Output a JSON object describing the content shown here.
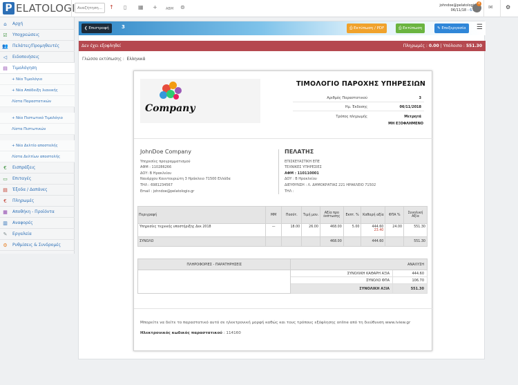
{
  "topbar": {
    "logo_letter": "P",
    "logo_text": "ELATOLOGIO",
    "search_placeholder": "Αναζήτηση...",
    "user_email": "johndoe@pelatologio.gr",
    "user_date": "06/11/18",
    "user_version": "6.2.87",
    "notif_count": "4"
  },
  "sidebar": {
    "items": [
      {
        "label": "Αρχή",
        "icon": "home-icon"
      },
      {
        "label": "Υποχρεώσεις",
        "icon": "check-icon"
      },
      {
        "label": "Πελάτες/Προμηθευτές",
        "icon": "users-icon"
      },
      {
        "label": "Ειδοποιήσεις",
        "icon": "megaphone-icon"
      },
      {
        "label": "Τιμολόγηση",
        "icon": "invoice-icon"
      }
    ],
    "subitems": [
      {
        "label": "+ Νέο Τιμολόγιο"
      },
      {
        "label": "+ Νέα Απόδειξη λιανικής"
      },
      {
        "label": "Λίστα Παραστατικών"
      },
      {
        "label": "+ Νέο Πιστωτικό Τιμολόγιο"
      },
      {
        "label": "Λίστα Πιστωτικών"
      },
      {
        "label": "+ Νέο Δελτίο αποστολής"
      },
      {
        "label": "Λίστα Δελτίων αποστολής"
      }
    ],
    "items2": [
      {
        "label": "Εισπράξεις",
        "icon": "euro-icon"
      },
      {
        "label": "Επιταγές",
        "icon": "cheque-icon"
      },
      {
        "label": "Έξοδα / Δαπάνες",
        "icon": "expenses-icon"
      },
      {
        "label": "Πληρωμές",
        "icon": "euro-out-icon"
      },
      {
        "label": "Αποθήκη - Προϊόντα",
        "icon": "warehouse-icon"
      },
      {
        "label": "Αναφορές",
        "icon": "reports-icon"
      },
      {
        "label": "Εργαλεία",
        "icon": "tools-icon"
      },
      {
        "label": "Ρυθμίσεις & Συνδρομές",
        "icon": "settings-icon"
      }
    ]
  },
  "actionbar": {
    "back_label": "Επιστροφή",
    "doc_number": "3",
    "pdf_label": "Εκτύπωση / PDF",
    "print_label": "Εκτύπωση",
    "edit_label": "Επεξεργασία"
  },
  "payband": {
    "status": "Δεν έχει εξοφληθεί",
    "paid_label": "Πληρωμές :",
    "paid": "0.00",
    "balance_label": "Υπόλοιπο :",
    "balance": "551.30"
  },
  "lang": {
    "label": "Γλώσσα εκτύπωσης",
    "value": "Ελληνικά"
  },
  "invoice": {
    "logo_text": "Company",
    "title": "ΤΙΜΟΛΟΓΙΟ ΠΑΡΟΧΗΣ ΥΠΗΡΕΣΙΩΝ",
    "number_label": "Αριθμός Παραστατικού",
    "number": "3",
    "date_label": "Ημ. Έκδοσης",
    "date": "06/11/2018",
    "payment_label": "Τρόπος πληρωμής",
    "payment": "Μετρητά",
    "payment_status": "ΜΗ ΕΞΟΦΛΗΜΕΝΟ",
    "seller": {
      "name": "JohnDoe Company",
      "activity": "Υπηρεσίες προγραμματισμού",
      "afm": "ΑΦΜ : 110286266",
      "doy": "ΔΟΥ: Β Ηρακλείου",
      "address": "Ναυάρχου Κουντουριώτη 3 Ηράκλειο 71500 Ελλάδα",
      "phone": "ΤΗΛ : 6981234567",
      "email": "Email : johndoe@pelatologio.gr"
    },
    "buyer": {
      "heading": "ΠΕΛΑΤΗΣ",
      "name": "ΕΠΙΣΚΕΥΑΣΤΙΚΗ ΕΠΕ",
      "activity": "ΤΕΧΝΙΚΕΣ ΥΠΗΡΕΣΙΕΣ",
      "afm": "ΑΦΜ : 110110001",
      "doy": "ΔΟΥ : Β Ηρακλείου",
      "address": "ΔΙΕΥΘΥΝΣΗ : Λ. ΔΗΜΟΚΡΑΤΙΑΣ 221 ΗΡΑΚΛΕΙΟ 71502",
      "phone": "ΤΗΛ :"
    },
    "table_headers": [
      "Περιγραφή",
      "ΜΜ",
      "Ποσότ.",
      "Τιμή μον.",
      "Αξία προ έκπτωσης",
      "Εκπτ. %",
      "Καθαρή αξία",
      "ΦΠΑ %",
      "Συνολική Αξία"
    ],
    "rows": [
      {
        "desc": "Υπηρεσίες τεχνικής υποστήριξης Δεκ 2018",
        "mm": "—",
        "qty": "18.00",
        "price": "26.00",
        "gross": "468.00",
        "disc": "5.00",
        "net": "444.60",
        "net_note": "23.40",
        "vat": "24.00",
        "total": "551.30"
      }
    ],
    "totals_label": "ΣΥΝΟΛΟ",
    "totals_gross": "468.00",
    "totals_net": "444.60",
    "totals_total": "551.30",
    "notes_heading": "ΠΛΗΡΟΦΟΡΙΕΣ - ΠΑΡΑΤΗΡΗΣΕΙΣ",
    "analysis_heading": "ΑΝΑΛΥΣΗ",
    "net_total_label": "ΣΥΝΟΛΙΚΗ ΚΑΘΑΡΗ ΑΞΙΑ",
    "net_total": "444.60",
    "vat_total_label": "ΣΥΝΟΛΟ ΦΠΑ",
    "vat_total": "106.70",
    "grand_total_label": "ΣΥΝΟΛΙΚΗ ΑΞΙΑ",
    "grand_total": "551.30",
    "online_note": "Μπορείτε να δείτε το παραστατικό αυτό σε ηλεκτρονική μορφή καθώς και τους τρόπους εξόφλησης online από τη διεύθυνση www.iview.gr",
    "code_label": "Ηλεκτρονικός κωδικός παραστατικού",
    "code": ": 114160"
  }
}
